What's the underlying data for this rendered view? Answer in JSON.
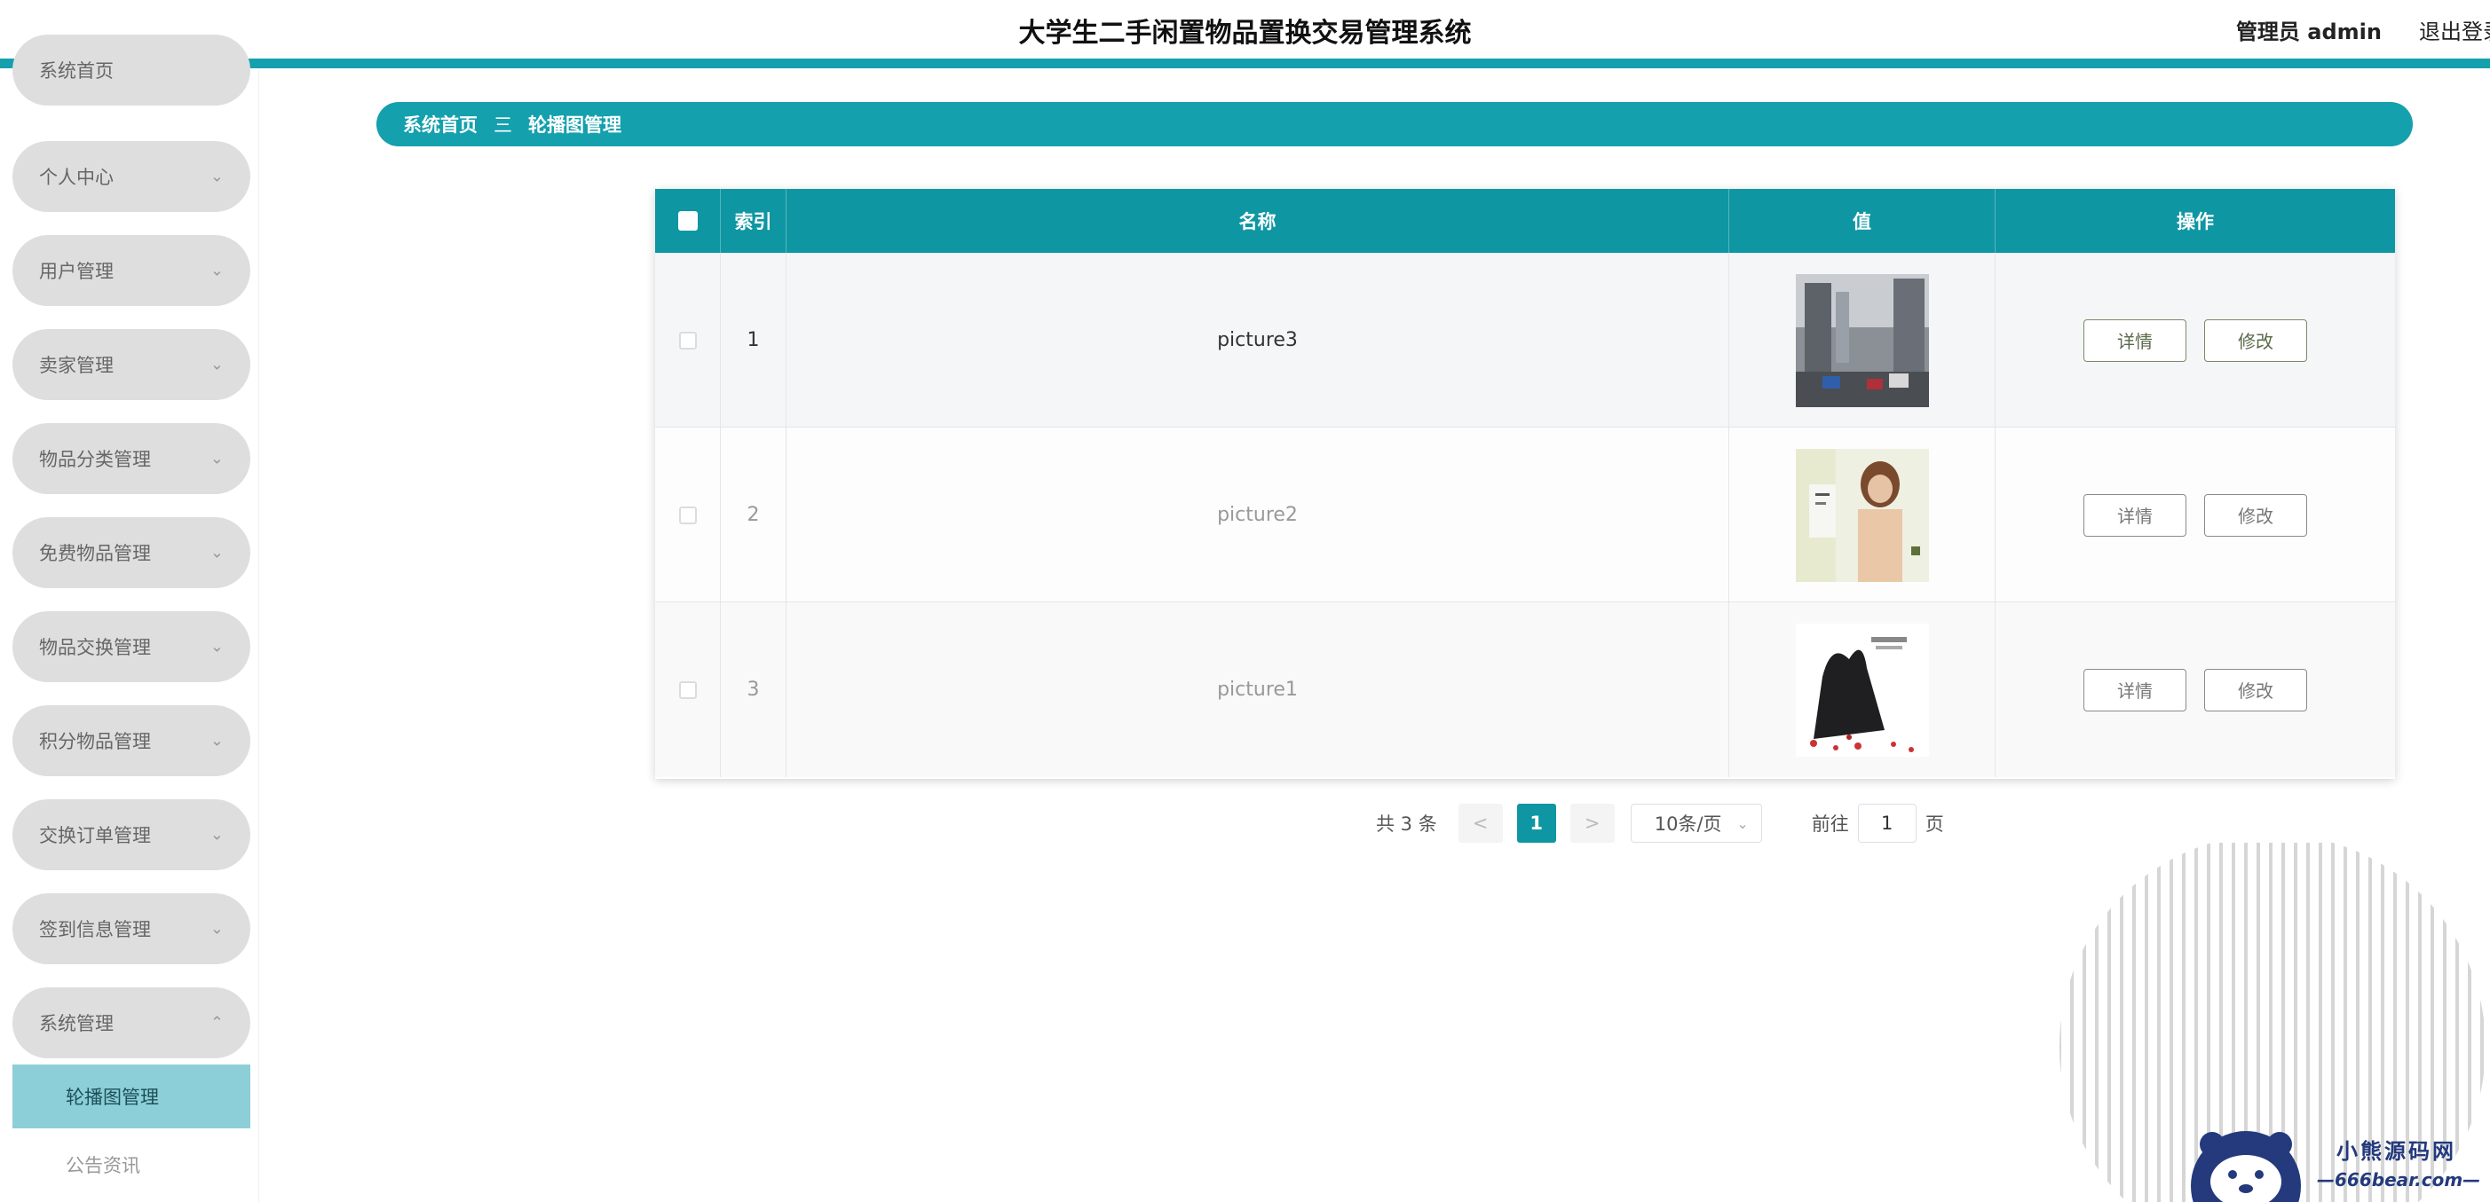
{
  "header": {
    "title": "大学生二手闲置物品置换交易管理系统",
    "user": "管理员 admin",
    "logout": "退出登录"
  },
  "colors": {
    "accent": "#14a0ad",
    "active_menu": "#8ccfd8"
  },
  "sidebar": {
    "items": [
      {
        "label": "系统首页"
      },
      {
        "label": "个人中心"
      },
      {
        "label": "用户管理"
      },
      {
        "label": "卖家管理"
      },
      {
        "label": "物品分类管理"
      },
      {
        "label": "免费物品管理"
      },
      {
        "label": "物品交换管理"
      },
      {
        "label": "积分物品管理"
      },
      {
        "label": "交换订单管理"
      },
      {
        "label": "签到信息管理"
      },
      {
        "label": "系统管理"
      }
    ],
    "submenu": [
      {
        "label": "轮播图管理",
        "active": true
      },
      {
        "label": "公告资讯",
        "active": false
      }
    ]
  },
  "breadcrumb": {
    "home": "系统首页",
    "separator": "三",
    "current": "轮播图管理"
  },
  "table": {
    "columns": [
      "索引",
      "名称",
      "值",
      "操作"
    ],
    "rows": [
      {
        "index": "1",
        "name": "picture3",
        "image": "street-photo",
        "detail": "详情",
        "edit": "修改"
      },
      {
        "index": "2",
        "name": "picture2",
        "image": "portrait-photo",
        "detail": "详情",
        "edit": "修改"
      },
      {
        "index": "3",
        "name": "picture1",
        "image": "bag-photo",
        "detail": "详情",
        "edit": "修改"
      }
    ]
  },
  "pagination": {
    "total": "共 3 条",
    "prev": "<",
    "current_page": "1",
    "next": ">",
    "page_size": "10条/页",
    "goto_label": "前往",
    "goto_value": "1",
    "page_unit": "页"
  },
  "watermark": {
    "title": "小熊源码网",
    "url": "—666bear.com—"
  }
}
